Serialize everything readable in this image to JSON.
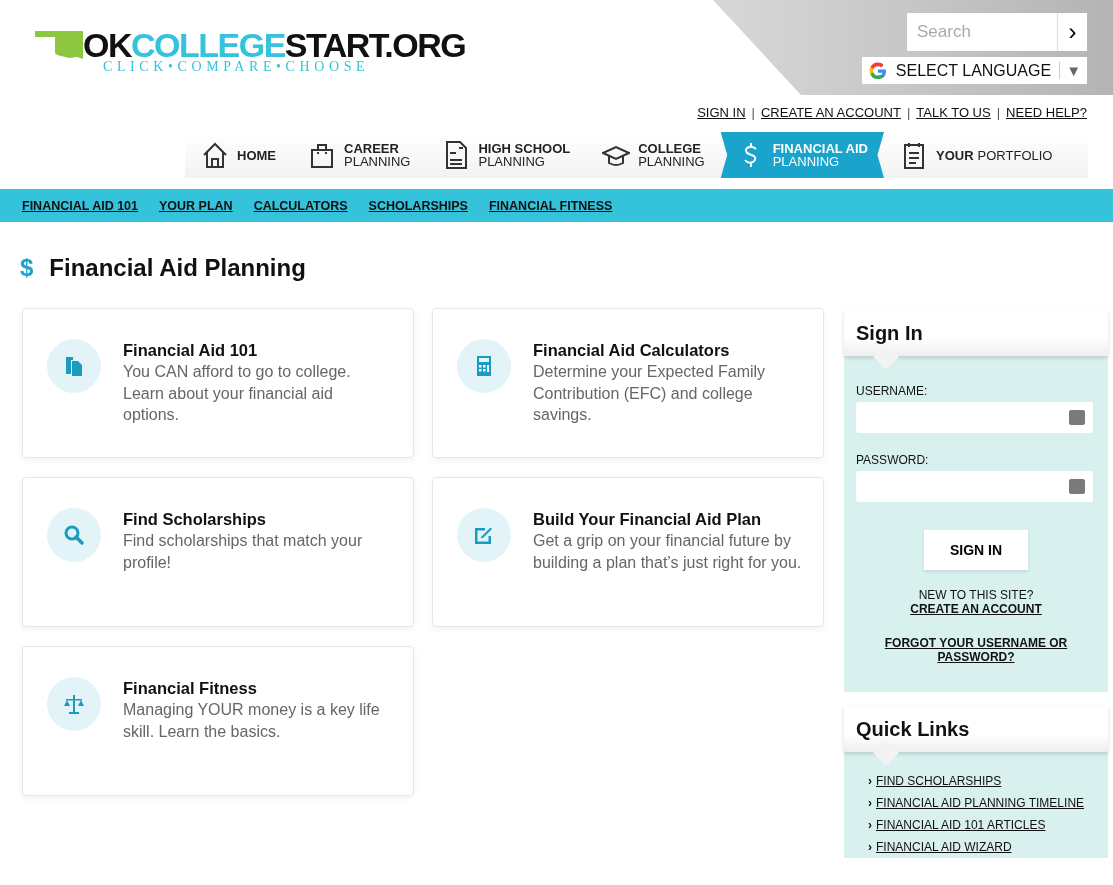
{
  "logo": {
    "parts": [
      {
        "text": "OK",
        "kind": "dark"
      },
      {
        "text": "COLLEGE",
        "kind": "accent"
      },
      {
        "text": "START.ORG",
        "kind": "dark"
      }
    ],
    "tagline": "CLICK•COMPARE•CHOOSE"
  },
  "search": {
    "placeholder": "Search",
    "button": "›"
  },
  "language": {
    "label": "SELECT LANGUAGE",
    "caret": "▼"
  },
  "top_links": [
    "SIGN IN",
    "CREATE AN ACCOUNT",
    "TALK TO US",
    "NEED HELP?"
  ],
  "top_link_separators": [
    "|",
    "|",
    "|"
  ],
  "nav": [
    {
      "bold": "HOME",
      "kind": "single",
      "selected": false
    },
    {
      "bold": "CAREER",
      "rest": "PLANNING",
      "kind": "stacked",
      "selected": false
    },
    {
      "bold": "HIGH SCHOOL",
      "rest": "PLANNING",
      "kind": "stacked",
      "selected": false
    },
    {
      "bold": "COLLEGE",
      "rest": "PLANNING",
      "kind": "stacked",
      "selected": false
    },
    {
      "bold": "FINANCIAL AID",
      "rest": "PLANNING",
      "kind": "stacked",
      "selected": true
    },
    {
      "bold": "YOUR",
      "rest": "PORTFOLIO",
      "kind": "inline",
      "selected": false
    }
  ],
  "subnav": [
    "FINANCIAL AID 101",
    "YOUR PLAN",
    "CALCULATORS",
    "SCHOLARSHIPS",
    "FINANCIAL FITNESS"
  ],
  "page_title": {
    "icon": "$",
    "text": "Financial Aid Planning"
  },
  "cards": [
    {
      "kind": "clipboard",
      "title": "Financial Aid 101",
      "text": "You CAN afford to go to college. Learn about your financial aid options."
    },
    {
      "kind": "calculator",
      "title": "Financial Aid Calculators",
      "text": "Determine your Expected Family Contribution (EFC) and college savings."
    },
    {
      "kind": "search",
      "title": "Find Scholarships",
      "text": "Find scholarships that match your profile!"
    },
    {
      "kind": "edit",
      "title": "Build Your Financial Aid Plan",
      "text": "Get a grip on your financial future by building a plan that’s just right for you."
    },
    {
      "kind": "scale",
      "title": "Financial Fitness",
      "text": "Managing YOUR money is a key life skill. Learn the basics."
    }
  ],
  "sign_in": {
    "title": "Sign In",
    "username_label": "USERNAME:",
    "password_label": "PASSWORD:",
    "button": "SIGN IN",
    "new_prompt": "NEW TO THIS SITE?",
    "create_link": "CREATE AN ACCOUNT",
    "forgot_link": "FORGOT YOUR USERNAME OR PASSWORD?"
  },
  "quick_links": {
    "title": "Quick Links",
    "bullet": "›",
    "items": [
      "FIND SCHOLARSHIPS",
      "FINANCIAL AID PLANNING TIMELINE",
      "FINANCIAL AID 101 ARTICLES",
      "FINANCIAL AID WIZARD"
    ]
  }
}
